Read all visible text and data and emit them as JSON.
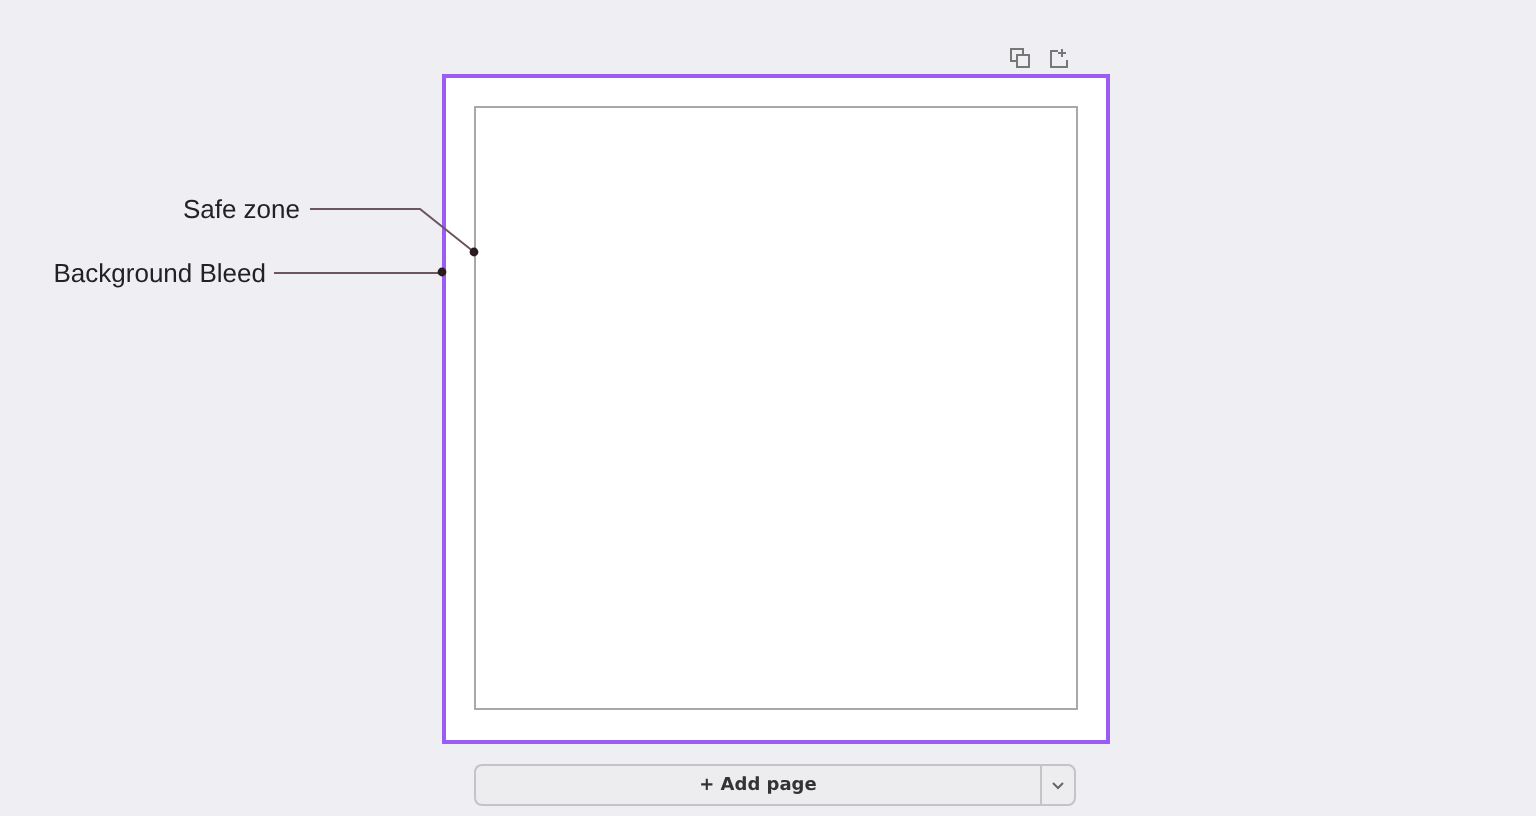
{
  "annotations": [
    {
      "kind": "safe",
      "label": "Safe zone"
    },
    {
      "kind": "bleed",
      "label": "Background Bleed"
    }
  ],
  "add_page": {
    "label": "+ Add page"
  }
}
